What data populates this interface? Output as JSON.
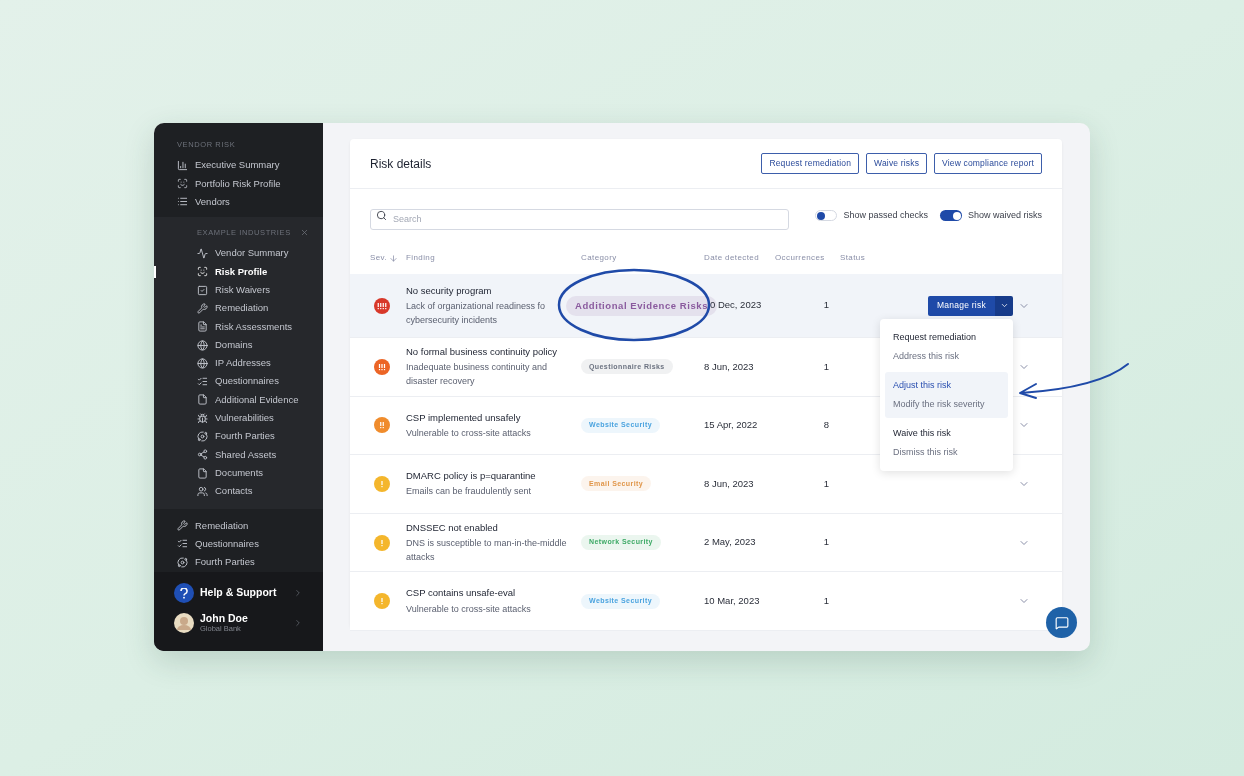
{
  "sidebar": {
    "heading": "VENDOR RISK",
    "items": [
      {
        "label": "Executive Summary",
        "selected": false
      },
      {
        "label": "Portfolio Risk Profile",
        "selected": false
      },
      {
        "label": "Vendors",
        "selected": false
      }
    ],
    "subpanel": {
      "heading": "EXAMPLE INDUSTRIES",
      "items": [
        {
          "label": "Vendor Summary",
          "selected": false
        },
        {
          "label": "Risk Profile",
          "selected": true
        },
        {
          "label": "Risk Waivers",
          "selected": false
        },
        {
          "label": "Remediation",
          "selected": false
        },
        {
          "label": "Risk Assessments",
          "selected": false
        },
        {
          "label": "Domains",
          "selected": false
        },
        {
          "label": "IP Addresses",
          "selected": false
        },
        {
          "label": "Questionnaires",
          "selected": false
        },
        {
          "label": "Additional Evidence",
          "selected": false
        },
        {
          "label": "Vulnerabilities",
          "selected": false
        },
        {
          "label": "Fourth Parties",
          "selected": false
        },
        {
          "label": "Shared Assets",
          "selected": false
        },
        {
          "label": "Documents",
          "selected": false
        },
        {
          "label": "Contacts",
          "selected": false
        }
      ]
    },
    "more_items": [
      {
        "label": "Remediation",
        "selected": false
      },
      {
        "label": "Questionnaires",
        "selected": false
      },
      {
        "label": "Fourth Parties",
        "selected": false
      }
    ],
    "help": {
      "label": "Help & Support"
    },
    "user": {
      "name": "John Doe",
      "org": "Global Bank"
    }
  },
  "card": {
    "title": "Risk details",
    "actions": [
      "Request remediation",
      "Waive risks",
      "View compliance report"
    ],
    "search": {
      "placeholder": "Search"
    },
    "toggles": [
      {
        "label": "Show passed checks",
        "on": false
      },
      {
        "label": "Show waived risks",
        "on": true
      }
    ],
    "columns": [
      "Sev.",
      "Finding",
      "Category",
      "Date detected",
      "Occurrences",
      "Status"
    ],
    "rows": [
      {
        "kind": "critical",
        "title": "No security program",
        "description": "Lack of organizational readiness fo\ncybersecurity incidents",
        "category": {
          "label": "Additional Evidence Risks",
          "color": "#8a5a9e",
          "highlighted": true
        },
        "date": "0 Dec, 2023",
        "occurrences": "1",
        "selected": true
      },
      {
        "kind": "high",
        "title": "No formal business continuity policy",
        "description": "Inadequate business continuity and disaster recovery",
        "category": {
          "label": "Questionnaire Risks",
          "color": "#6b7280",
          "highlighted": false
        },
        "date": "8 Jun, 2023",
        "occurrences": "1",
        "selected": false
      },
      {
        "kind": "medium",
        "title": "CSP implemented unsafely",
        "description": "Vulnerable to cross-site attacks",
        "category": {
          "label": "Website Security",
          "color": "#4aa3df",
          "highlighted": false
        },
        "date": "15 Apr, 2022",
        "occurrences": "8",
        "selected": false
      },
      {
        "kind": "low",
        "title": "DMARC policy is p=quarantine",
        "description": "Emails can be fraudulently sent",
        "category": {
          "label": "Email Security",
          "color": "#e0964a",
          "highlighted": false
        },
        "date": "8 Jun, 2023",
        "occurrences": "1",
        "selected": false
      },
      {
        "kind": "low",
        "title": "DNSSEC not enabled",
        "description": "DNS is susceptible to man-in-the-middle attacks",
        "category": {
          "label": "Network Security",
          "color": "#3daa66",
          "highlighted": false
        },
        "date": "2 May, 2023",
        "occurrences": "1",
        "selected": false
      },
      {
        "kind": "low",
        "title": "CSP contains unsafe-eval",
        "description": "Vulnerable to cross-site attacks",
        "category": {
          "label": "Website Security",
          "color": "#4aa3df",
          "highlighted": false
        },
        "date": "10 Mar, 2023",
        "occurrences": "1",
        "selected": false
      }
    ],
    "manage_button": {
      "label": "Manage risk"
    },
    "menu": [
      {
        "title": "Request remediation",
        "subtitle": "Address this risk",
        "selected": false
      },
      {
        "title": "Adjust this risk",
        "subtitle": "Modify the risk severity",
        "selected": true
      },
      {
        "title": "Waive this risk",
        "subtitle": "Dismiss this risk",
        "selected": false
      }
    ]
  }
}
